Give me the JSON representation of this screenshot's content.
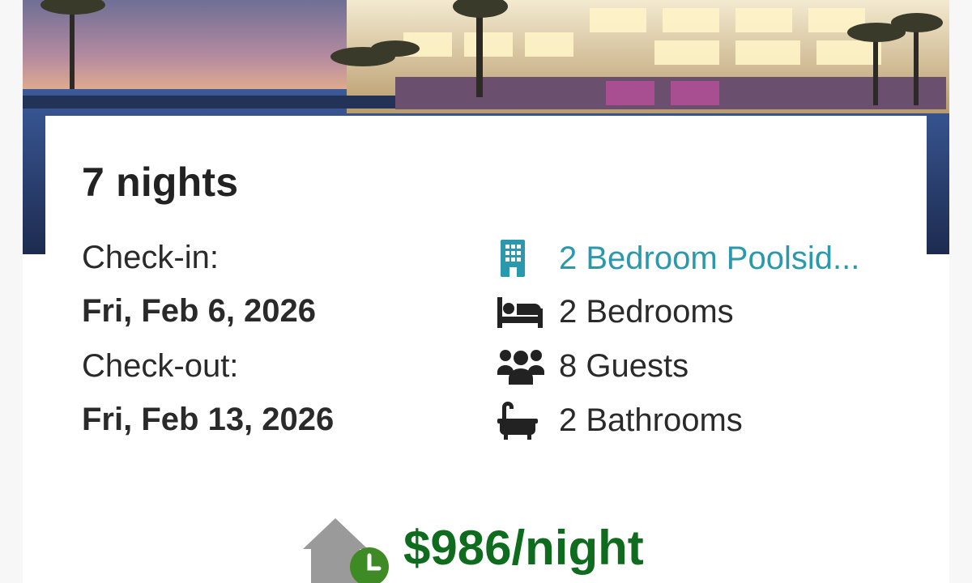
{
  "stay": {
    "nights_label": "7 nights",
    "checkin_label": "Check-in:",
    "checkin_date": "Fri, Feb 6, 2026",
    "checkout_label": "Check-out:",
    "checkout_date": "Fri, Feb 13, 2026"
  },
  "amenities": {
    "unit": {
      "icon": "building-icon",
      "label": "2 Bedroom Poolsid..."
    },
    "bedrooms": {
      "icon": "bed-icon",
      "label": "2 Bedrooms"
    },
    "guests": {
      "icon": "guests-icon",
      "label": "8 Guests"
    },
    "bathrooms": {
      "icon": "bathtub-icon",
      "label": "2 Bathrooms"
    }
  },
  "price": {
    "icon": "house-clock-icon",
    "label": "$986/night"
  },
  "colors": {
    "link": "#2a98ad",
    "price": "#0f6b1d",
    "text": "#2a2a2a",
    "clock_badge": "#3e8a24",
    "house_icon": "#9a9a9a"
  }
}
